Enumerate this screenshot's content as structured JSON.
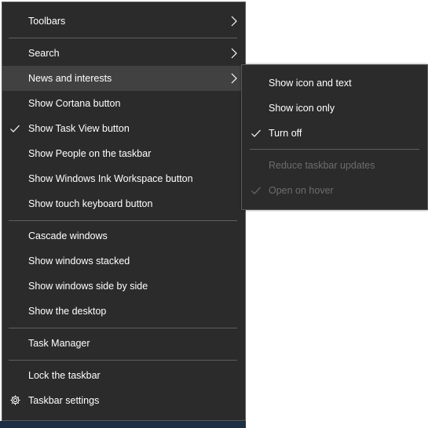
{
  "main_menu": {
    "items": [
      {
        "label": "Toolbars"
      },
      {
        "label": "Search"
      },
      {
        "label": "News and interests"
      },
      {
        "label": "Show Cortana button"
      },
      {
        "label": "Show Task View button"
      },
      {
        "label": "Show People on the taskbar"
      },
      {
        "label": "Show Windows Ink Workspace button"
      },
      {
        "label": "Show touch keyboard button"
      },
      {
        "label": "Cascade windows"
      },
      {
        "label": "Show windows stacked"
      },
      {
        "label": "Show windows side by side"
      },
      {
        "label": "Show the desktop"
      },
      {
        "label": "Task Manager"
      },
      {
        "label": "Lock the taskbar"
      },
      {
        "label": "Taskbar settings"
      }
    ],
    "checked_items": [
      "Show Task View button"
    ],
    "hovered_item": "News and interests"
  },
  "sub_menu": {
    "items": [
      {
        "label": "Show icon and text"
      },
      {
        "label": "Show icon only"
      },
      {
        "label": "Turn off"
      },
      {
        "label": "Reduce taskbar updates"
      },
      {
        "label": "Open on hover"
      }
    ],
    "checked_items": [
      "Turn off",
      "Open on hover"
    ],
    "disabled_items": [
      "Reduce taskbar updates",
      "Open on hover"
    ]
  },
  "colors": {
    "menu_background": "#2b2b2b",
    "hover_background": "#414141",
    "text": "#ffffff",
    "disabled_text": "#6d6d6d",
    "taskbar": "#1e2f44"
  },
  "icons": [
    "chevron-right-icon",
    "checkmark-icon",
    "gear-icon"
  ]
}
